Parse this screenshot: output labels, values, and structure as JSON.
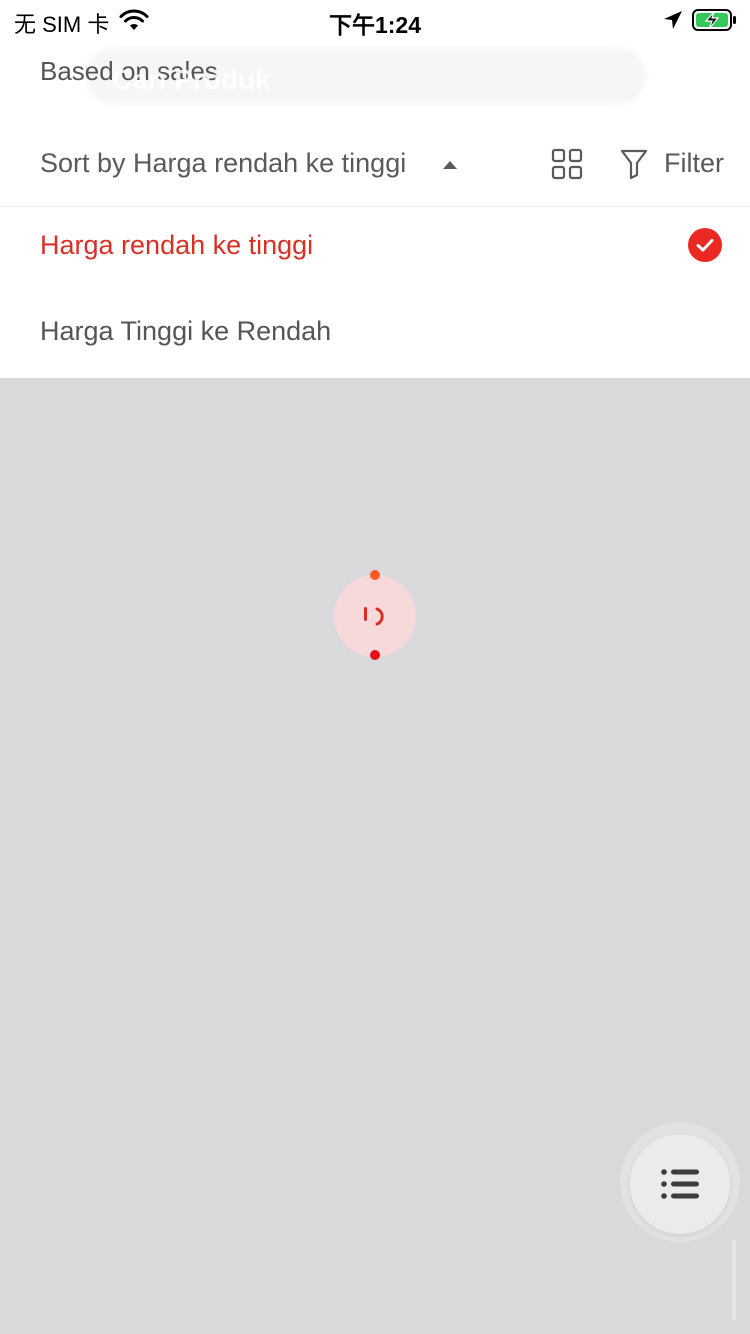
{
  "status_bar": {
    "carrier": "无 SIM 卡",
    "time": "下午1:24",
    "icons": [
      "wifi-icon",
      "location-arrow-icon",
      "battery-charging-icon"
    ]
  },
  "header": {
    "subtitle": "Based on sales",
    "search_ghost_text": "Cari Produk"
  },
  "sort_bar": {
    "label": "Sort by Harga rendah ke tinggi",
    "filter_label": "Filter",
    "icons": [
      "grid-view-icon",
      "filter-funnel-icon"
    ]
  },
  "sort_options": [
    {
      "label": "Harga rendah ke tinggi",
      "selected": true
    },
    {
      "label": "Harga Tinggi ke Rendah",
      "selected": false
    }
  ],
  "loader": {
    "icon": "loading-spinner-icon"
  },
  "fab": {
    "icon": "list-menu-icon"
  },
  "colors": {
    "accent": "#d93025",
    "check": "#ea2a22",
    "overlay": "#d9d9db",
    "text_muted": "#5a5a5a"
  }
}
